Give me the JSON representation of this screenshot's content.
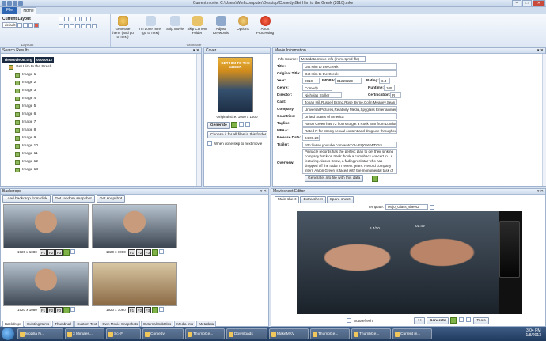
{
  "window": {
    "title": "Current movie: C:\\Users\\Workcomputer\\Desktop\\Comedy\\Get Him to the Greek (2010).mkv"
  },
  "ribbon": {
    "file_tab": "File",
    "home_tab": "Home",
    "current_layout_label": "Current Layout",
    "layout_value": "default",
    "layouts_group": "Layouts",
    "generate_group": "Generate",
    "buttons": {
      "generate_all": "Generate them! (and go to next)",
      "done_here": "I'm done here! (go to next)",
      "skip": "Skip Movie",
      "skip_folder": "Skip Current Folder",
      "adjust": "Adjust Keywords",
      "options": "Options",
      "abort": "Abort Processing"
    }
  },
  "search": {
    "title": "Search Results",
    "root": "TheMovieDB.org",
    "root_id": "00000012",
    "movie": "Get Him to the Greek",
    "images": [
      "Image 1",
      "Image 2",
      "Image 3",
      "Image 4",
      "Image 5",
      "Image 6",
      "Image 7",
      "Image 8",
      "Image 9",
      "Image 10",
      "Image 11",
      "Image 12",
      "Image 13"
    ]
  },
  "cover": {
    "title": "Cover",
    "poster_text": "GET HIM TO THE GREEK",
    "original_size": "Original size: 1000 x 1500",
    "generate": "Generate",
    "choose_all": "Choose it for all files in this folder...",
    "when_done": "When done skip to next movie"
  },
  "movie_info": {
    "title": "Movie Information",
    "info_source_label": "Info Source:",
    "info_source_value": "Metadata movie info (from .tgmd file)",
    "labels": {
      "title": "Title:",
      "original_title": "Original Title:",
      "year": "Year:",
      "imdb": "IMDB Id:",
      "rating": "Rating:",
      "genre": "Genre:",
      "runtime": "Runtime:",
      "director": "Director:",
      "certification": "Certification:",
      "cast": "Cast:",
      "company": "Company:",
      "countries": "Countries:",
      "tagline": "Tagline:",
      "mpaa": "MPAA:",
      "release": "Release Date:",
      "trailer": "Trailer:",
      "overview": "Overview:"
    },
    "values": {
      "title": "Get Him to the Greek",
      "original_title": "Get Him to the Greek",
      "year": "2010",
      "imdb": "tt1226229",
      "rating": "6.4",
      "genre": "Comedy",
      "runtime": "109",
      "director": "Nicholas Stoller",
      "certification": "R",
      "cast": "Jonah Hill,Russell Brand,Rose Byrne,Colm Meaney,Sean 'P. Diddy' Combs",
      "company": "Universal Pictures,Relativity Media,Spyglass Entertainment,Apatow",
      "countries": "United States of America",
      "tagline": "Aaron Green has 72 hours to get a Rock Star from London to L.A.",
      "mpaa": "Rated R for strong sexual content and drug use throughout, and",
      "release": "04.06.2010",
      "trailer": "http://www.youtube.com/watch?v=FQ0b6-WDGrs",
      "overview": "Pinnacle records has the perfect plan to get their sinking company back on track: book a comeback concert in LA featuring Aldous Snow, a fading rockstar who has dropped off the radar in recent years. Record company intern Aaron Green is faced with the monumental task of bringing his"
    },
    "generate_nfo": "Generate .nfo file with this data"
  },
  "backdrops": {
    "title": "Backdrops",
    "load_btn": "Load backdrop from disk",
    "random_btn": "Get random snapshot",
    "snapshot_btn": "Get snapshot",
    "resolution": "1920 x 1080",
    "f1": "F1",
    "f2": "F2",
    "f3": "F3"
  },
  "bottom_tabs_left": [
    "Backdrops",
    "Existing Items",
    "Thumbnail",
    "Custom Text",
    "Own Movie Snapshots",
    "External Subtitles",
    "Media Info",
    "Metadata"
  ],
  "moviesheet": {
    "title": "Moviesheet Editor",
    "tabs": [
      "Main sheet",
      "Extra sheet",
      "Spare sheet"
    ],
    "template_label": "Template:",
    "template_value": "Mojo_Glass_sheet2",
    "preview_rating": "6.4/10",
    "preview_info": "01:49",
    "autorefresh": "Autorefresh",
    "generate": "Generate",
    "tools": "Tools"
  },
  "taskbar": {
    "items": [
      "Mozilla Fi...",
      "3 Minutes...",
      "Sci-Fi",
      "Comedy",
      "ThumbGe...",
      "Downloads",
      "MakeMKV",
      "ThumbGe...",
      "ThumbGe...",
      "Current m..."
    ],
    "time": "3:04 PM",
    "date": "1/8/2013"
  }
}
